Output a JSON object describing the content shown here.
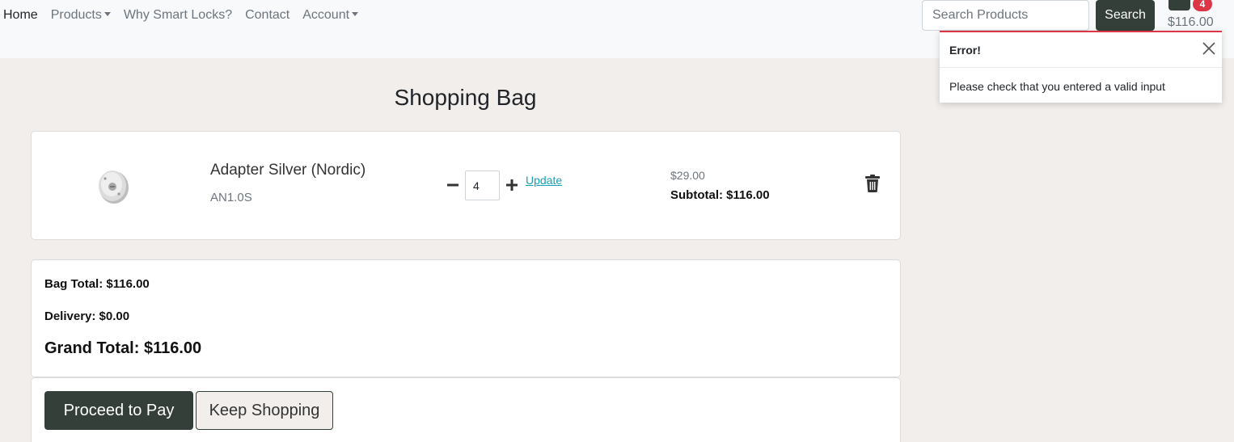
{
  "nav": {
    "items": [
      {
        "label": "Home",
        "dropdown": false,
        "active": true
      },
      {
        "label": "Products",
        "dropdown": true,
        "active": false
      },
      {
        "label": "Why Smart Locks?",
        "dropdown": false,
        "active": false
      },
      {
        "label": "Contact",
        "dropdown": false,
        "active": false
      },
      {
        "label": "Account",
        "dropdown": true,
        "active": false
      }
    ],
    "search_placeholder": "Search Products",
    "search_button": "Search",
    "bag_count": "4",
    "bag_total": "$116.00"
  },
  "toast": {
    "title": "Error!",
    "message": "Please check that you entered a valid input"
  },
  "page": {
    "title": "Shopping Bag"
  },
  "item": {
    "name": "Adapter Silver (Nordic)",
    "sku": "AN1.0S",
    "quantity": "4",
    "update_label": "Update",
    "price": "$29.00",
    "subtotal": "Subtotal: $116.00"
  },
  "totals": {
    "bag_total": "Bag Total: $116.00",
    "delivery": "Delivery: $0.00",
    "grand_total": "Grand Total: $116.00"
  },
  "actions": {
    "pay_label": "Proceed to Pay",
    "keep_label": "Keep Shopping"
  },
  "colors": {
    "primary": "#343f39",
    "danger": "#dc3545",
    "link": "#17a2b8",
    "page_background": "#f2eeec"
  },
  "icons": [
    "caret-down-icon",
    "shopping-bag-icon",
    "close-icon",
    "minus-icon",
    "plus-icon",
    "trash-icon"
  ]
}
